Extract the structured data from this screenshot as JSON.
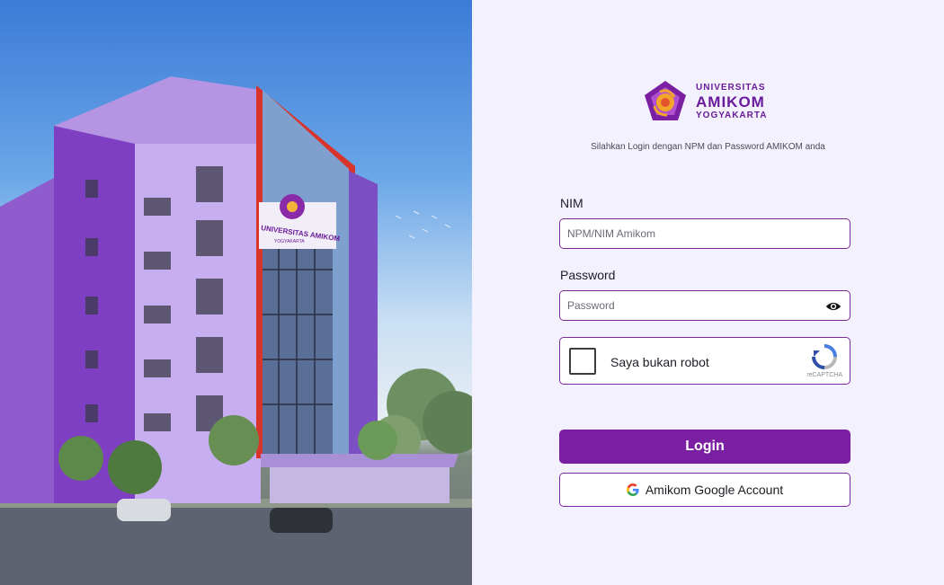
{
  "hero": {
    "building_sign": "UNIVERSITAS AMIKOM",
    "building_sign_sub": "YOGYAKARTA"
  },
  "logo": {
    "line1": "UNIVERSITAS",
    "line2": "AMIKOM",
    "line3": "YOGYAKARTA"
  },
  "subtitle": "Silahkan Login dengan NPM dan Password AMIKOM anda",
  "form": {
    "nim_label": "NIM",
    "nim_placeholder": "NPM/NIM Amikom",
    "nim_value": "",
    "password_label": "Password",
    "password_placeholder": "Password",
    "password_value": "",
    "captcha_label": "Saya bukan robot",
    "captcha_brand": "reCAPTCHA",
    "login_label": "Login",
    "google_label": "Amikom Google Account"
  },
  "colors": {
    "brand": "#7a1fa2",
    "border": "#7b2a9e",
    "panel_bg": "#f3f1fd"
  },
  "icons": {
    "password_toggle": "eye-icon",
    "google": "google-icon",
    "captcha": "recaptcha-icon",
    "logo": "amikom-logo-icon"
  }
}
